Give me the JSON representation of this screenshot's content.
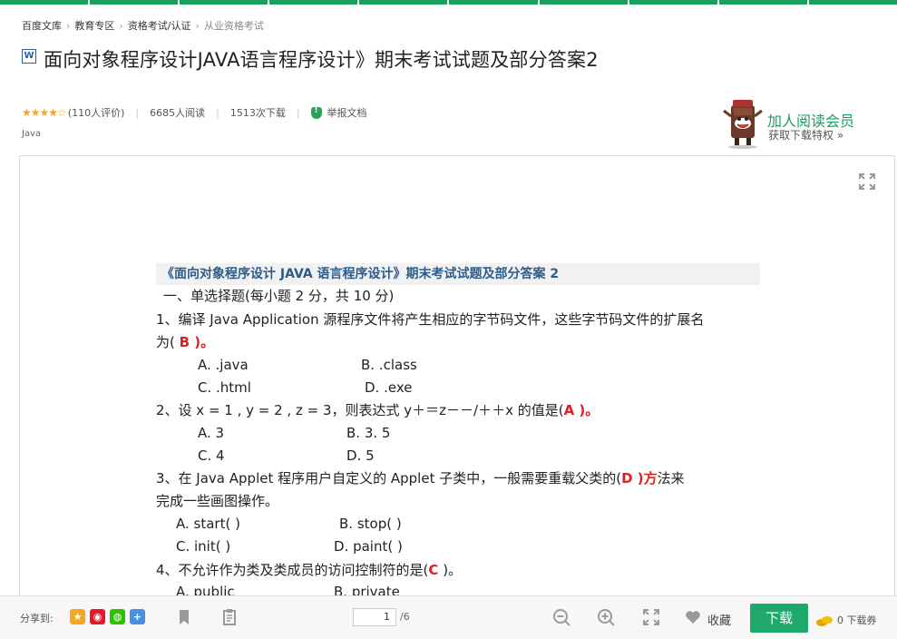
{
  "breadcrumb": [
    {
      "label": "百度文库"
    },
    {
      "label": "教育专区"
    },
    {
      "label": "资格考试/认证"
    },
    {
      "label": "从业资格考试"
    }
  ],
  "doc": {
    "type_icon": "W",
    "title": "面向对象程序设计JAVA语言程序设计》期末考试试题及部分答案2",
    "rating_stars": "★★★★☆",
    "rating_text": "(110人评价)",
    "reads": "6685人阅读",
    "downloads": "1513次下载",
    "report": "举报文档",
    "tag": "Java"
  },
  "vip": {
    "title": "加人阅读会员",
    "subtitle": "获取下载特权 »"
  },
  "content": {
    "heading": "《面向对象程序设计 JAVA 语言程序设计》期末考试试题及部分答案 2",
    "section": "一、单选择题(每小题 2 分，共 10 分)",
    "q1_pre": "1、编译 Java Application  源程序文件将产生相应的字节码文件，这些字节码文件的扩展名",
    "q1_l2_pre": "为(   ",
    "q1_ans": "B",
    "q1_l2_post": "   )。",
    "q1_a": "A.    .java",
    "q1_b": "B.    .class",
    "q1_c": "C.    .html",
    "q1_d": "D.    .exe",
    "q2_pre": "2、设  x = 1 , y = 2 , z = 3，则表达式  y＋＝z－－/＋＋x  的值是(",
    "q2_ans": "A",
    "q2_post": "    )。",
    "q2_a": "A.    3",
    "q2_b": "B.    3. 5",
    "q2_c": "C.    4",
    "q2_d": "D.    5",
    "q3_pre": "3、在 Java Applet 程序用户自定义的 Applet 子类中，一般需要重载父类的(",
    "q3_ans": "D",
    "q3_red": "   )方",
    "q3_post": "法来",
    "q3_l2": "完成一些画图操作。",
    "q3_a": "A.    start( )",
    "q3_b": "B.    stop( )",
    "q3_c": "C.    init( )",
    "q3_d": "D.    paint( )",
    "q4_pre": "4、不允许作为类及类成员的访问控制符的是(",
    "q4_ans": "C",
    "q4_post": "    )。",
    "q4_a": "A.    public",
    "q4_b": "B.    private"
  },
  "toolbar": {
    "share_label": "分享到:",
    "page_current": "1",
    "page_total": "/6",
    "favorite": "收藏",
    "download": "下载",
    "coupon": "0  下载券"
  },
  "colors": {
    "brand_green": "#1a9f5c",
    "answer_red": "#e02020",
    "heading_blue": "#2e5c8a"
  }
}
